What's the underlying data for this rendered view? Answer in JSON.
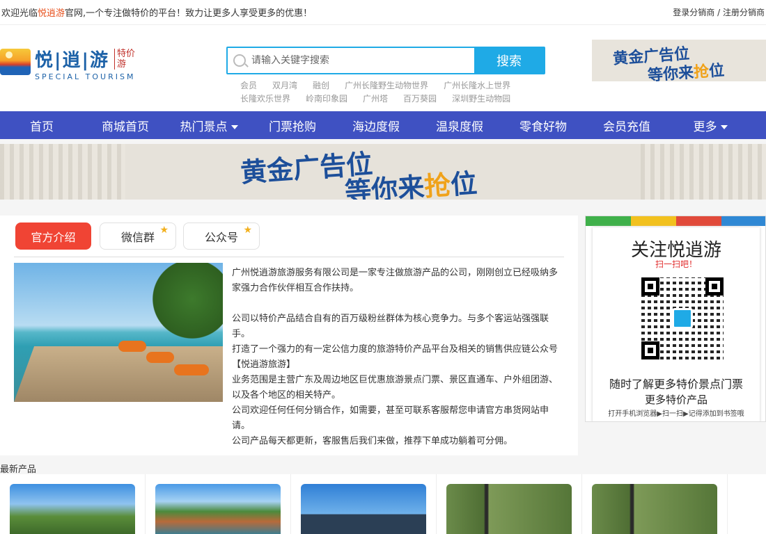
{
  "topbar": {
    "welcome_prefix": "欢迎光临",
    "welcome_brand": "悦逍游",
    "welcome_suffix": "官网,一个专注做特价的平台！致力让更多人享受更多的优惠！",
    "login_distributor": "登录分销商",
    "separator": "/",
    "register_distributor": "注册分销商"
  },
  "logo": {
    "name_cn": "悦|逍|游",
    "tag": "特价游",
    "name_en": "SPECIAL TOURISM"
  },
  "search": {
    "placeholder": "请输入关键字搜索",
    "button_label": "搜索",
    "hot_keywords": [
      "会员",
      "双月湾",
      "融创",
      "广州长隆野生动物世界",
      "广州长隆水上世界",
      "长隆欢乐世界",
      "岭南印象园",
      "广州塔",
      "百万葵园",
      "深圳野生动物园"
    ]
  },
  "ad": {
    "line1": "黄金广告位",
    "line2_a": "等你来",
    "line2_b": "抢",
    "line2_c": "位"
  },
  "nav": {
    "items": [
      {
        "label": "首页",
        "dropdown": false
      },
      {
        "label": "商城首页",
        "dropdown": false
      },
      {
        "label": "热门景点",
        "dropdown": true
      },
      {
        "label": "门票抢购",
        "dropdown": false
      },
      {
        "label": "海边度假",
        "dropdown": false
      },
      {
        "label": "温泉度假",
        "dropdown": false
      },
      {
        "label": "零食好物",
        "dropdown": false
      },
      {
        "label": "会员充值",
        "dropdown": false
      },
      {
        "label": "更多",
        "dropdown": true
      }
    ]
  },
  "about": {
    "tabs": [
      {
        "label": "官方介绍",
        "active": true,
        "star": false
      },
      {
        "label": "微信群",
        "active": false,
        "star": true
      },
      {
        "label": "公众号",
        "active": false,
        "star": true
      }
    ],
    "paragraphs": [
      "广州悦逍游旅游服务有限公司是一家专注做旅游产品的公司，刚刚创立已经吸纳多家强力合作伙伴相互合作扶持。",
      "",
      "公司以特价产品结合自有的百万级粉丝群体为核心竞争力。与多个客运站强强联手。",
      "打造了一个强力的有一定公信力度的旅游特价产品平台及相关的销售供应链公众号【悦逍游旅游】",
      "业务范围是主营广东及周边地区巨优惠旅游景点门票、景区直通车、户外组团游、以及各个地区的相关特产。",
      "公司欢迎任何任何分销合作，如需要，甚至可联系客服帮您申请官方串货网站申请。",
      "公司产品每天都更新，客服售后我们来做，推荐下单成功躺着可分佣。"
    ]
  },
  "qr_panel": {
    "title": "关注悦逍游",
    "scan": "扫一扫吧！",
    "line1": "随时了解更多特价景点门票",
    "line2": "更多特价产品",
    "line3": "打开手机浏览器▶扫一扫▶记得添加到书签哦"
  },
  "latest": {
    "title": "最新产品"
  },
  "colors": {
    "accent": "#1faae6",
    "nav": "#3f51c2",
    "active_tab": "#f04434",
    "brand_orange": "#e8501c"
  }
}
